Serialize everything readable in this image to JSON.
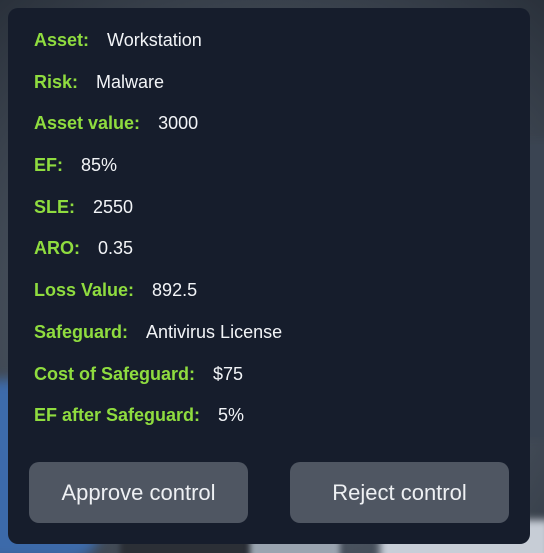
{
  "panel": {
    "rows": [
      {
        "label": "Asset:",
        "value": "Workstation"
      },
      {
        "label": "Risk:",
        "value": "Malware"
      },
      {
        "label": "Asset value:",
        "value": "3000"
      },
      {
        "label": "EF:",
        "value": "85%"
      },
      {
        "label": "SLE:",
        "value": "2550"
      },
      {
        "label": "ARO:",
        "value": "0.35"
      },
      {
        "label": "Loss Value:",
        "value": "892.5"
      },
      {
        "label": "Safeguard:",
        "value": "Antivirus License"
      },
      {
        "label": "Cost of Safeguard:",
        "value": "$75"
      },
      {
        "label": "EF after Safeguard:",
        "value": "5%"
      }
    ],
    "buttons": {
      "approve_label": "Approve control",
      "reject_label": "Reject control"
    }
  },
  "colors": {
    "panel_bg": "#161d2c",
    "label": "#8fdc3f",
    "value": "#f2f4f7",
    "button_bg": "#4f5662"
  }
}
